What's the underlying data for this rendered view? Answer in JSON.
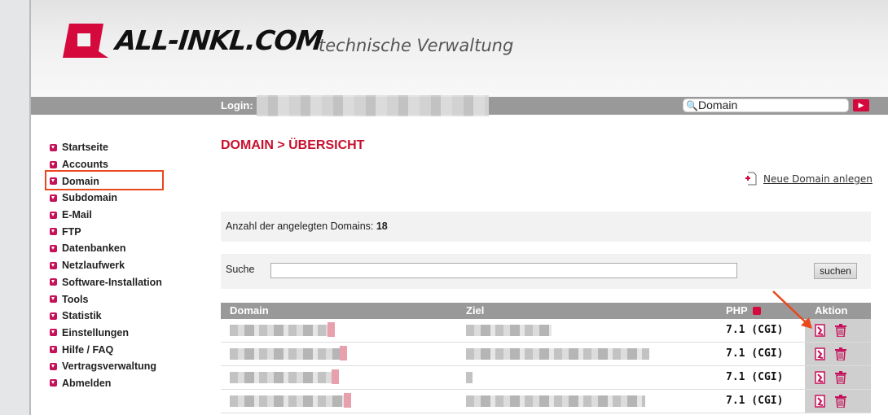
{
  "header": {
    "brand": "ALL-INKL.COM",
    "subtitle": "technische Verwaltung",
    "login_label": "Login:",
    "search_value": "Domain",
    "search_go": "▶",
    "brand_color": "#d5093c"
  },
  "sidebar": {
    "items": [
      {
        "label": "Startseite"
      },
      {
        "label": "Accounts"
      },
      {
        "label": "Domain",
        "highlighted": true
      },
      {
        "label": "Subdomain"
      },
      {
        "label": "E-Mail"
      },
      {
        "label": "FTP"
      },
      {
        "label": "Datenbanken"
      },
      {
        "label": "Netzlaufwerk"
      },
      {
        "label": "Software-Installation"
      },
      {
        "label": "Tools"
      },
      {
        "label": "Statistik"
      },
      {
        "label": "Einstellungen"
      },
      {
        "label": "Hilfe / FAQ"
      },
      {
        "label": "Vertragsverwaltung"
      },
      {
        "label": "Abmelden"
      }
    ]
  },
  "main": {
    "title": "DOMAIN > ÜBERSICHT",
    "new_domain_label": "Neue Domain anlegen",
    "count_label": "Anzahl der angelegten Domains:",
    "count_value": "18",
    "search_label": "Suche",
    "search_value": "",
    "search_button": "suchen",
    "table": {
      "columns": [
        "Domain",
        "Ziel",
        "PHP",
        "Aktion"
      ],
      "rows": [
        {
          "php": "7.1 (CGI)"
        },
        {
          "php": "7.1 (CGI)"
        },
        {
          "php": "7.1 (CGI)"
        },
        {
          "php": "7.1 (CGI)"
        }
      ]
    }
  }
}
